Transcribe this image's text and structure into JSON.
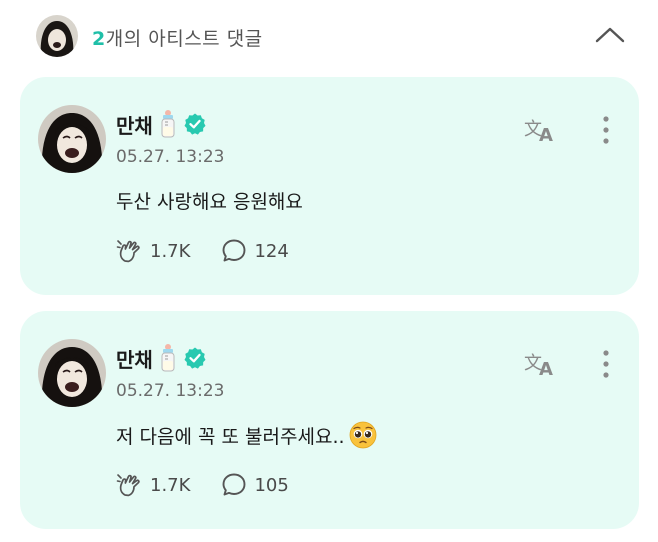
{
  "header": {
    "count": "2",
    "title_rest": "개의 아티스트 댓글"
  },
  "comments": [
    {
      "author": "만채",
      "date": "05.27. 13:23",
      "text": "두산 사랑해요 응원해요",
      "likes": "1.7K",
      "replies": "124",
      "has_pleading_emoji": false
    },
    {
      "author": "만채",
      "date": "05.27. 13:23",
      "text": "저 다음에 꼭 또 불러주세요..",
      "likes": "1.7K",
      "replies": "105",
      "has_pleading_emoji": true
    }
  ],
  "colors": {
    "accent": "#1fbfa8",
    "card_bg": "#e6fbf5",
    "verified": "#28c9b0"
  },
  "icons": {
    "author_emoji": "baby-bottle-icon",
    "verified": "verified-badge-icon",
    "translate": "translate-icon",
    "more": "more-vertical-icon",
    "like": "cheer-hand-icon",
    "reply": "speech-bubble-icon",
    "collapse": "chevron-up-icon"
  }
}
